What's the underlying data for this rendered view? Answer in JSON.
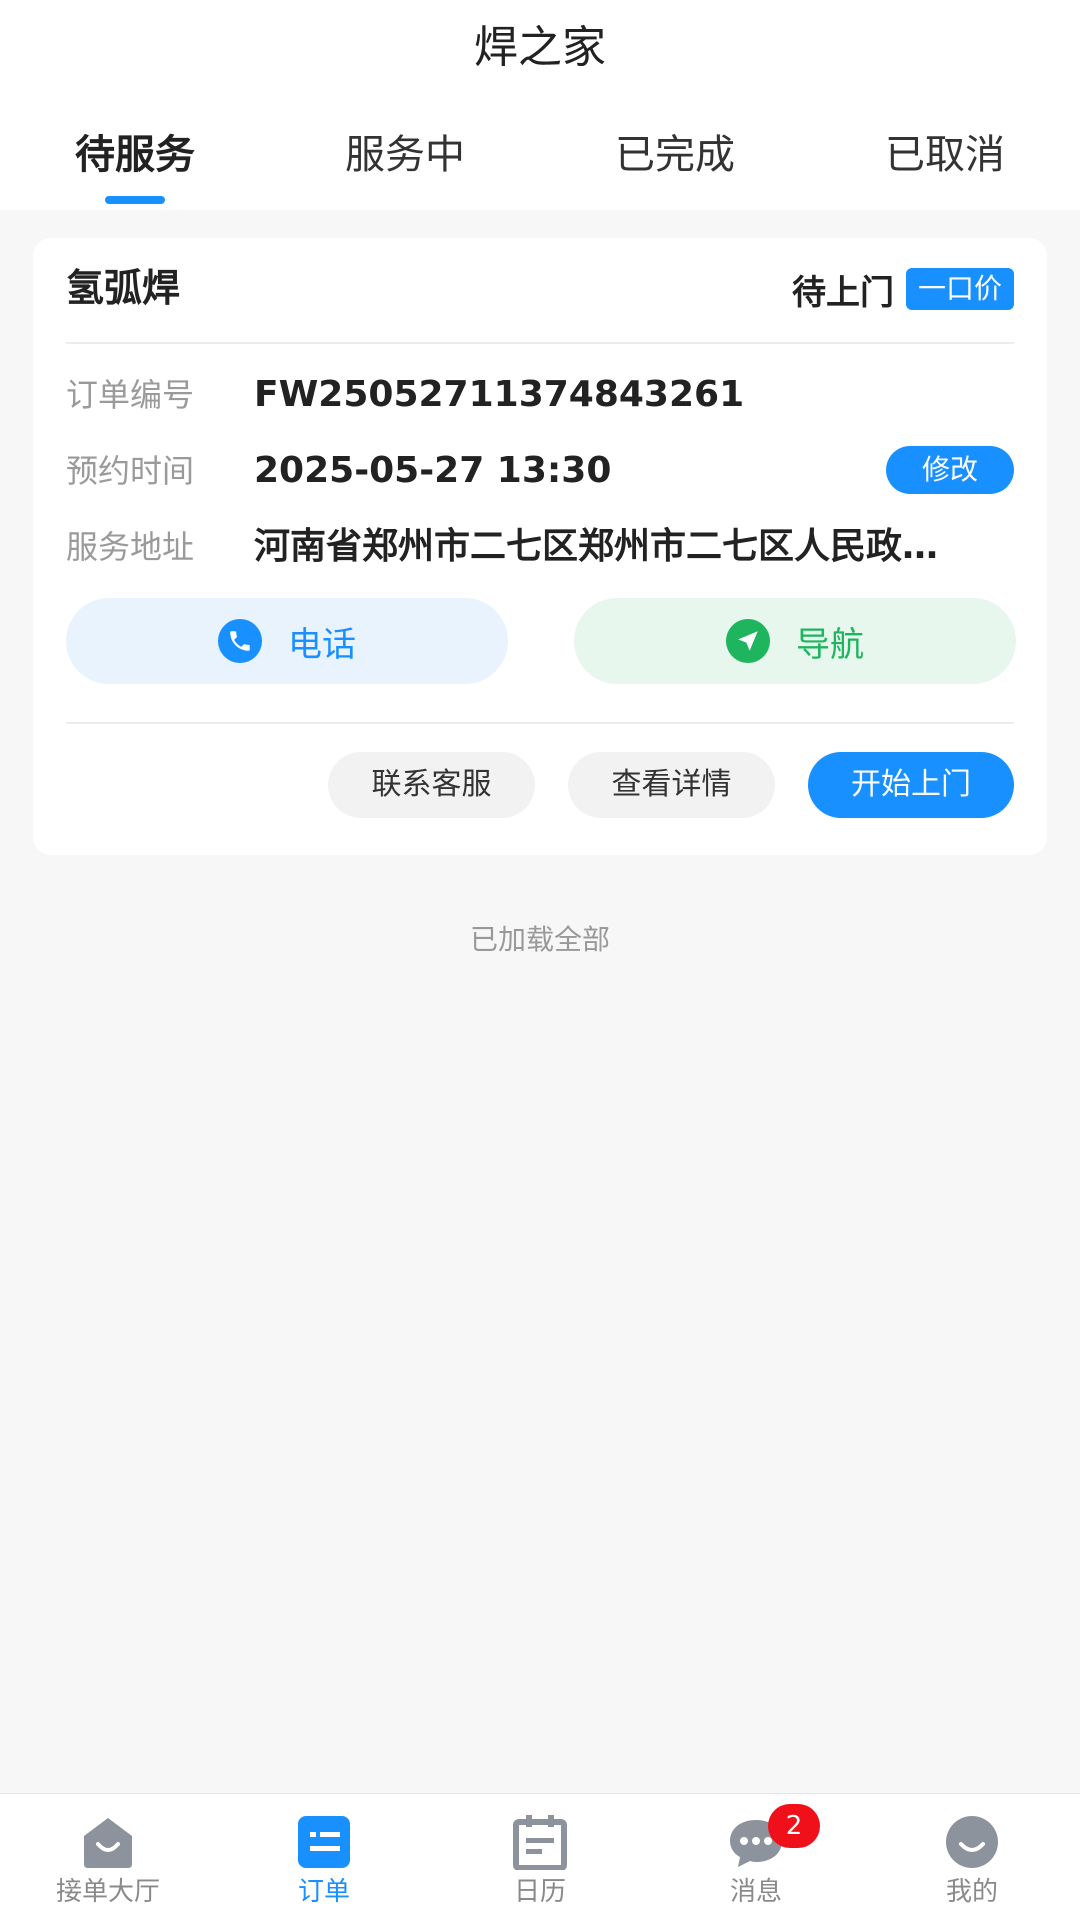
{
  "header": {
    "title": "焊之家",
    "tabs": [
      {
        "label": "待服务",
        "active": true
      },
      {
        "label": "服务中",
        "active": false
      },
      {
        "label": "已完成",
        "active": false
      },
      {
        "label": "已取消",
        "active": false
      }
    ]
  },
  "order": {
    "service_name": "氢弧焊",
    "status": "待上门",
    "price_badge": "一口价",
    "fields": [
      {
        "label": "订单编号",
        "value": "FW25052711374843261"
      },
      {
        "label": "预约时间",
        "value": "2025-05-27 13:30"
      },
      {
        "label": "服务地址",
        "value": "河南省郑州市二七区郑州市二七区人民政…"
      }
    ],
    "modify_label": "修改",
    "phone_label": "电话",
    "navigate_label": "导航",
    "actions": {
      "contact": "联系客服",
      "detail": "查看详情",
      "start": "开始上门"
    }
  },
  "list_footer": "已加载全部",
  "tabbar": {
    "items": [
      {
        "label": "接单大厅",
        "icon": "home-smile-icon",
        "active": false
      },
      {
        "label": "订单",
        "icon": "order-list-icon",
        "active": true
      },
      {
        "label": "日历",
        "icon": "calendar-icon",
        "active": false
      },
      {
        "label": "消息",
        "icon": "chat-bubble-icon",
        "active": false,
        "badge": "2"
      },
      {
        "label": "我的",
        "icon": "profile-icon",
        "active": false
      }
    ]
  },
  "colors": {
    "accent": "#1890ff",
    "success": "#1fb55e",
    "badge": "#f0101a",
    "background": "#f7f7f7"
  }
}
